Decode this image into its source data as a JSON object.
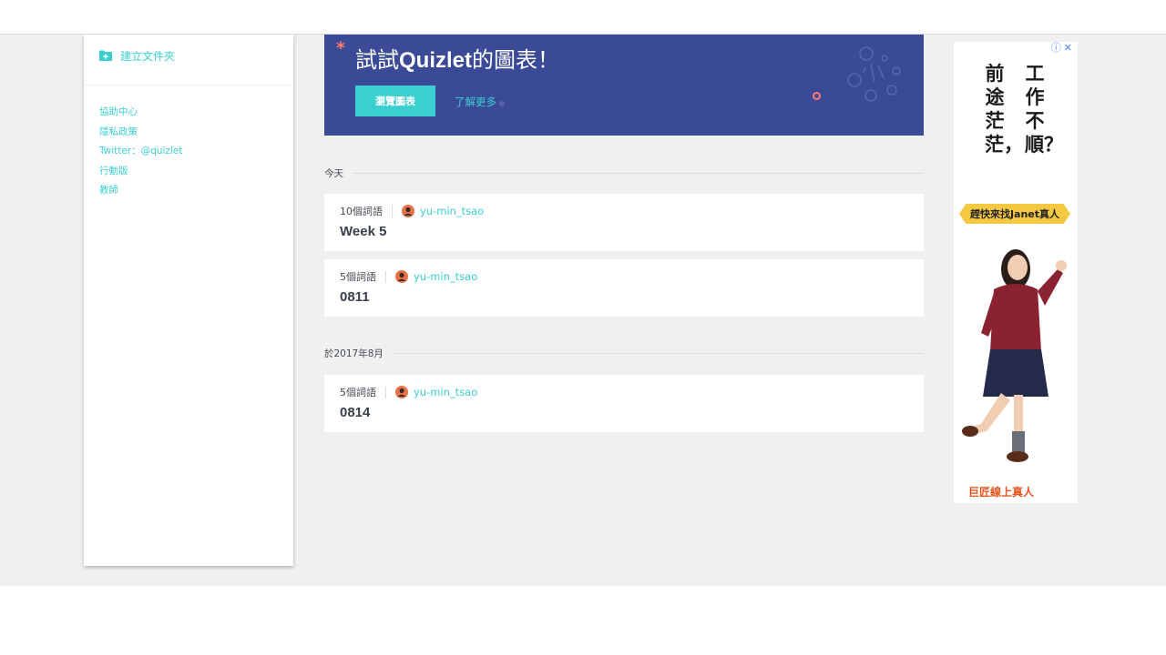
{
  "sidebar": {
    "create_folder": "建立文件夾",
    "footer_links": [
      "協助中心",
      "隱私政策",
      "Twitter：@quizlet",
      "行動版",
      "教師"
    ]
  },
  "banner": {
    "title_prefix": "試試",
    "title_brand": "Quizlet",
    "title_suffix": "的圖表！",
    "browse_button": "瀏覽圖表",
    "learn_more": "了解更多"
  },
  "sections": [
    {
      "label": "今天",
      "sets": [
        {
          "term_count": "10個詞語",
          "user": "yu-min_tsao",
          "title": "Week 5"
        },
        {
          "term_count": "5個詞語",
          "user": "yu-min_tsao",
          "title": "0811"
        }
      ]
    },
    {
      "label": "於2017年8月",
      "sets": [
        {
          "term_count": "5個詞語",
          "user": "yu-min_tsao",
          "title": "0814"
        }
      ]
    }
  ],
  "ad": {
    "info_icon": "ⓘ",
    "close_icon": "✕",
    "headline_right": "工作不順？",
    "headline_left": "前途茫茫，",
    "tag": "趕快來找Janet真人",
    "brand": "巨匠線上真人"
  },
  "colors": {
    "accent": "#3ccfcf",
    "banner_bg": "#3b4a96",
    "star": "#ff7a6b",
    "page_bg": "#f0f0f0",
    "title_text": "#38414a"
  }
}
